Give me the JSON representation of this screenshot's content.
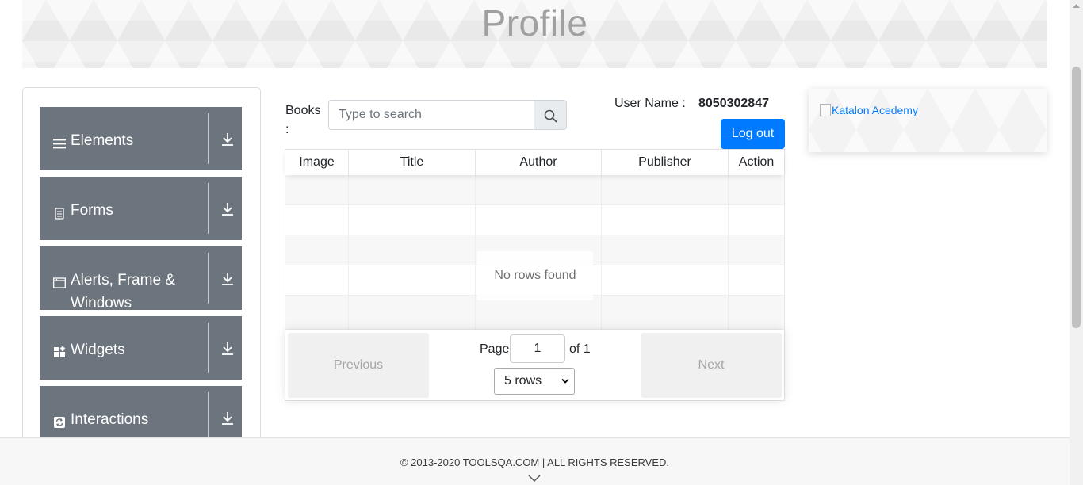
{
  "header": {
    "title": "Profile"
  },
  "sidebar": {
    "groups": [
      {
        "label": "Elements",
        "icon": "menu-icon"
      },
      {
        "label": "Forms",
        "icon": "form-icon"
      },
      {
        "label": "Alerts, Frame & Windows",
        "icon": "window-icon"
      },
      {
        "label": "Widgets",
        "icon": "widgets-icon"
      },
      {
        "label": "Interactions",
        "icon": "interactions-icon"
      }
    ]
  },
  "books": {
    "label": "Books :",
    "search_placeholder": "Type to search"
  },
  "user": {
    "label": "User Name :",
    "value": "8050302847",
    "logout_label": "Log out"
  },
  "table": {
    "columns": [
      "Image",
      "Title",
      "Author",
      "Publisher",
      "Action"
    ],
    "empty_message": "No rows found",
    "pagination": {
      "previous_label": "Previous",
      "next_label": "Next",
      "page_label": "Page",
      "page_value": "1",
      "of_label": "of 1",
      "rows_selected": "5 rows"
    }
  },
  "ad": {
    "alt_text": "Katalon Acedemy"
  },
  "footer": {
    "copyright": "© 2013-2020 TOOLSQA.COM | ALL RIGHTS RESERVED."
  },
  "colors": {
    "primary": "#007bff",
    "menu_group": "#6c757d",
    "title_gray": "#a0a0a0"
  }
}
